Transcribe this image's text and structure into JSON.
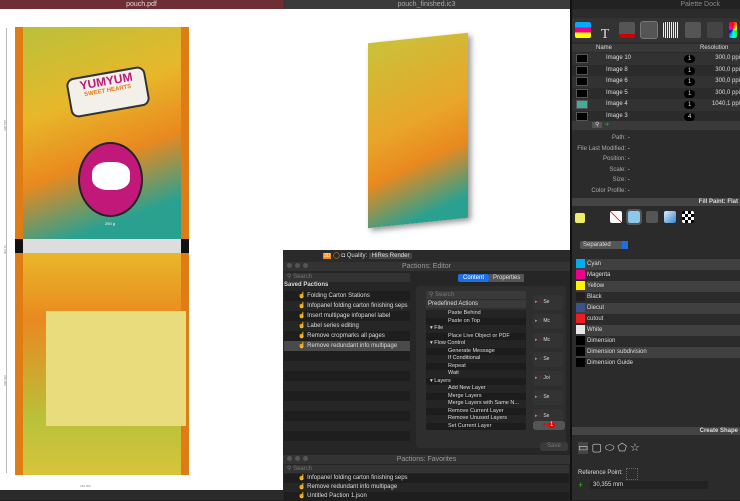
{
  "left_window": {
    "title": "pouch.pdf",
    "dims": [
      "220,000",
      "34,000",
      "220,000",
      "180,000"
    ],
    "art": {
      "brand": "YUMYUM",
      "sub": "SWEET HEARTS",
      "weight": "250 g"
    }
  },
  "middle_window": {
    "title": "pouch_finished.ic3",
    "quality_label": "Quality:",
    "quality_value": "HiRes Render"
  },
  "editor": {
    "title": "Pactions: Editor",
    "search_placeholder": "Search",
    "saved_header": "Saved Pactions",
    "saved": [
      "Folding Carton Stations",
      "Infopanel folding carton finishing seps",
      "Insert multipage infopanel label",
      "Label series editing",
      "Remove cropmarks all pages",
      "Remove redundant info  multipage"
    ],
    "tabs": [
      "Content",
      "Properties"
    ],
    "predefined_header": "Predefined Actions",
    "tree": [
      {
        "t": "Paste Behind",
        "l": 2
      },
      {
        "t": "Paste on Top",
        "l": 2
      },
      {
        "t": "File",
        "l": 1
      },
      {
        "t": "Place Live Object or PDF",
        "l": 2
      },
      {
        "t": "Flow Control",
        "l": 1
      },
      {
        "t": "Generate Message",
        "l": 2
      },
      {
        "t": "If Conditional",
        "l": 2
      },
      {
        "t": "Repeat",
        "l": 2
      },
      {
        "t": "Wait",
        "l": 2
      },
      {
        "t": "Layers",
        "l": 1
      },
      {
        "t": "Add New Layer",
        "l": 2
      },
      {
        "t": "Merge Layers",
        "l": 2
      },
      {
        "t": "Merge Layers with Same N...",
        "l": 2
      },
      {
        "t": "Remove Current Layer",
        "l": 2
      },
      {
        "t": "Remove Unused Layers",
        "l": 2
      },
      {
        "t": "Set Current Layer",
        "l": 2
      }
    ],
    "steps": [
      "Se",
      "Mc",
      "Mc",
      "Se",
      "Joi",
      "Se",
      "Se"
    ],
    "error_count": "1",
    "save_label": "Save"
  },
  "favorites": {
    "title": "Pactions: Favorites",
    "search_placeholder": "Search",
    "items": [
      "Infopanel folding carton finishing seps",
      "Remove redundant info  multipage",
      "Untitled Paction 1.json"
    ]
  },
  "dock": {
    "title": "Palette Dock",
    "col_name": "Name",
    "col_res": "Resolution",
    "images": [
      {
        "name": "Image 10",
        "count": "1",
        "res": "300,0 ppi"
      },
      {
        "name": "Image 8",
        "count": "1",
        "res": "300,0 ppi"
      },
      {
        "name": "Image 6",
        "count": "1",
        "res": "300,0 ppi"
      },
      {
        "name": "Image 5",
        "count": "1",
        "res": "300,0 ppi"
      },
      {
        "name": "Image 4",
        "count": "1",
        "res": "1040,1 ppi"
      },
      {
        "name": "Image 3",
        "count": "4",
        "res": ""
      }
    ],
    "info": [
      {
        "k": "Path:",
        "v": "-"
      },
      {
        "k": "File Last Modified:",
        "v": "-"
      },
      {
        "k": "Position:",
        "v": "-"
      },
      {
        "k": "Scale:",
        "v": "-"
      },
      {
        "k": "Size:",
        "v": "-"
      },
      {
        "k": "Color Profile:",
        "v": "-"
      }
    ],
    "fill_title": "Fill Paint: Flat",
    "mode": "Separated",
    "inks": [
      {
        "n": "Cyan",
        "c": "#00aeef"
      },
      {
        "n": "Magenta",
        "c": "#ec008c"
      },
      {
        "n": "Yellow",
        "c": "#fff200"
      },
      {
        "n": "Black",
        "c": "#231f20"
      },
      {
        "n": "Diecut",
        "c": "#3b5488"
      },
      {
        "n": "cutout",
        "c": "#ed1c24"
      },
      {
        "n": "White",
        "c": "#e8e8e8"
      },
      {
        "n": "Dimension",
        "c": "#000000"
      },
      {
        "n": "Dimension subdivision",
        "c": "#000000"
      },
      {
        "n": "Dimension Guide",
        "c": "#000000"
      }
    ],
    "shape_title": "Create Shape",
    "ref_label": "Reference Point:",
    "width_value": "30,355 mm"
  }
}
